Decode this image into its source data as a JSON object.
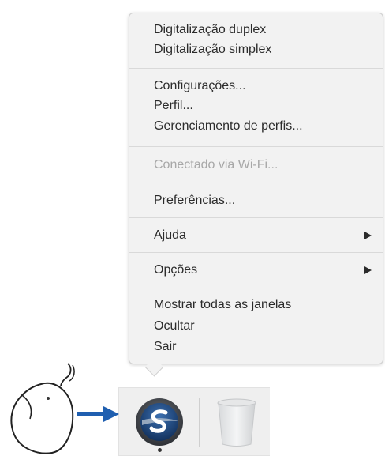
{
  "menu": {
    "items": [
      {
        "label": "Digitalização duplex",
        "enabled": true
      },
      {
        "label": "Digitalização simplex",
        "enabled": true
      },
      {
        "label": "Configurações...",
        "enabled": true
      },
      {
        "label": "Perfil...",
        "enabled": true
      },
      {
        "label": "Gerenciamento de perfis...",
        "enabled": true
      },
      {
        "label": "Conectado via Wi-Fi...",
        "enabled": false
      },
      {
        "label": "Preferências...",
        "enabled": true
      },
      {
        "label": "Ajuda",
        "enabled": true,
        "submenu": true
      },
      {
        "label": "Opções",
        "enabled": true,
        "submenu": true
      },
      {
        "label": "Mostrar todas as janelas",
        "enabled": true
      },
      {
        "label": "Ocultar",
        "enabled": true
      },
      {
        "label": "Sair",
        "enabled": true
      }
    ]
  },
  "dock": {
    "app_icon": "scansnap-app-icon",
    "trash_icon": "trash-icon"
  },
  "illustration": {
    "mouse_icon": "mouse-icon",
    "arrow_icon": "right-arrow-icon",
    "arrow_color": "#1f5fb0"
  }
}
